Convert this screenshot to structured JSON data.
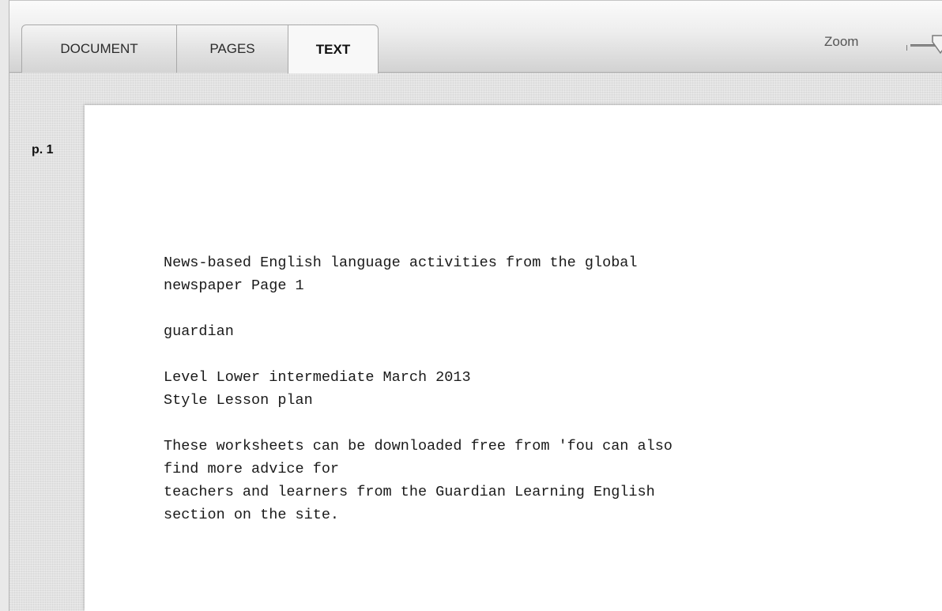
{
  "tabs": [
    {
      "label": "DOCUMENT",
      "active": false
    },
    {
      "label": "PAGES",
      "active": false
    },
    {
      "label": "TEXT",
      "active": true
    }
  ],
  "zoom": {
    "label": "Zoom"
  },
  "page": {
    "label": "p. 1",
    "paragraphs": [
      [
        "News-based English language activities from the global",
        "newspaper Page 1"
      ],
      [
        "guardian"
      ],
      [
        "Level Lower intermediate March 2013",
        "Style Lesson plan"
      ],
      [
        "These worksheets can be downloaded free from 'fou can also",
        "find more advice for",
        "teachers and learners from the Guardian Learning English",
        "section on the site."
      ]
    ]
  },
  "colors": {
    "active_tab_bg": "#f8f8f8",
    "page_bg": "#ffffff",
    "workspace_bg": "#e2e2e2"
  }
}
